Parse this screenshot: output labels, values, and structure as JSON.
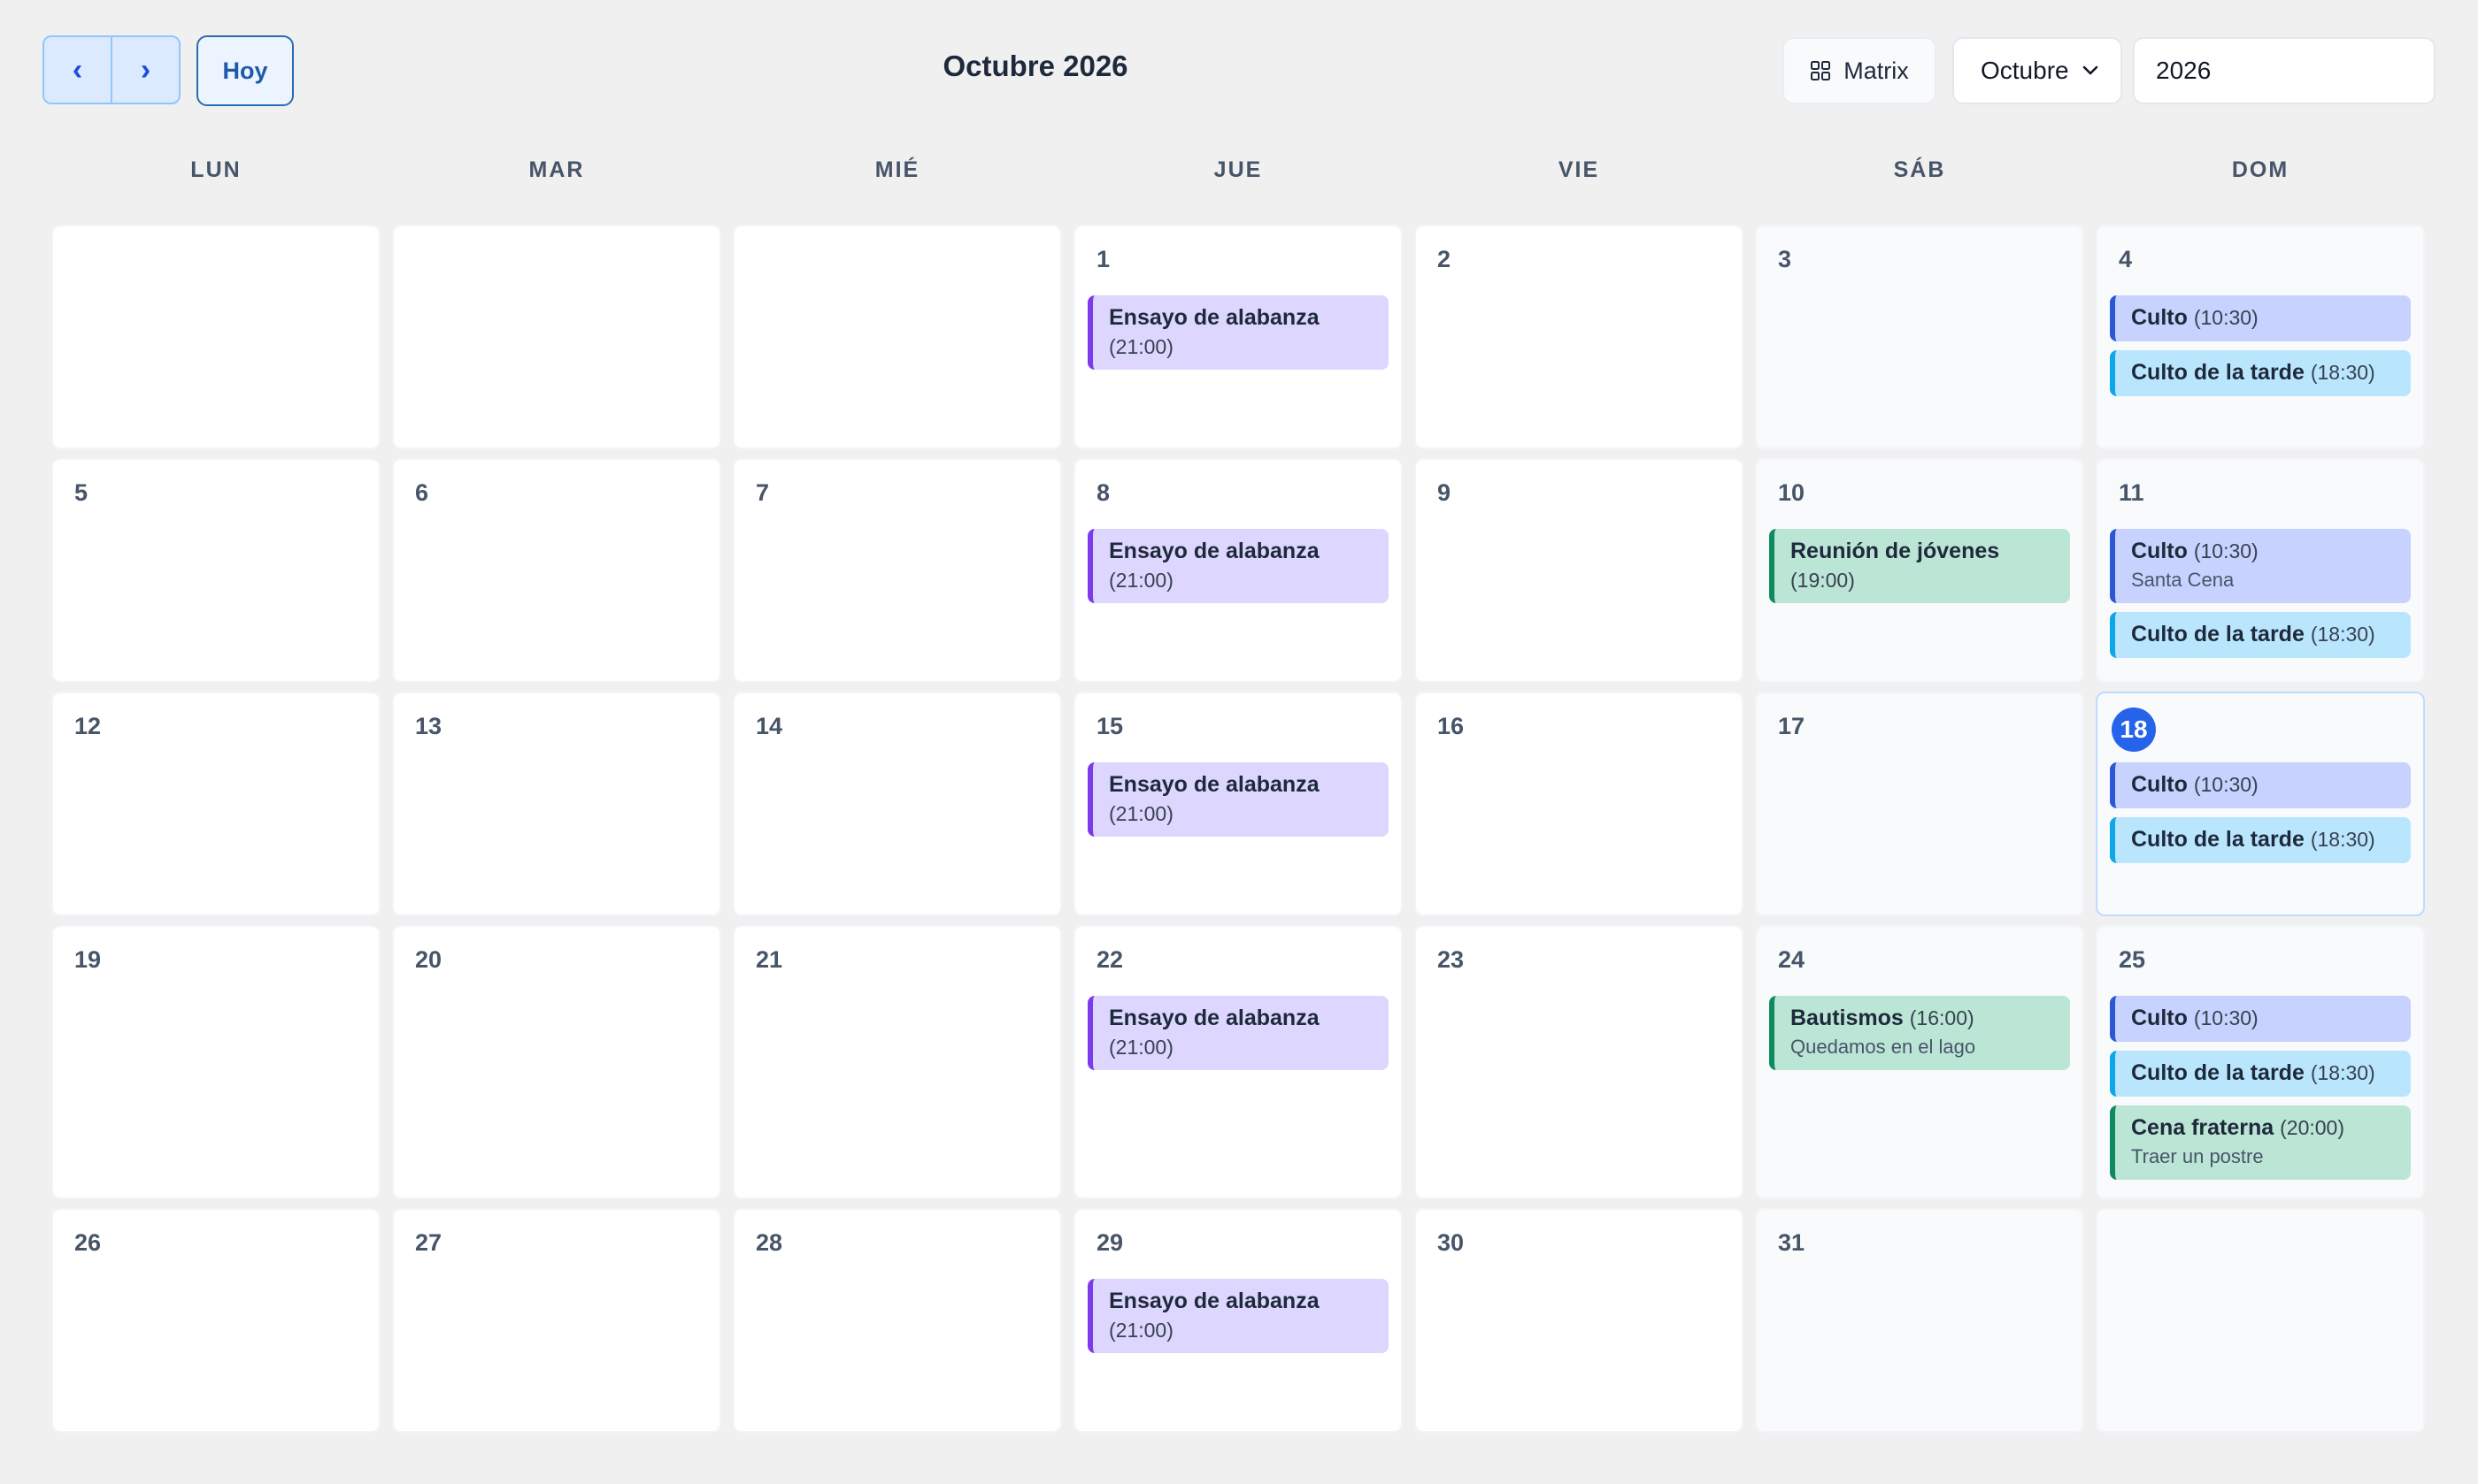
{
  "toolbar": {
    "prev_label": "‹",
    "next_label": "›",
    "today_label": "Hoy",
    "title": "Octubre 2026",
    "view_label": "Matrix",
    "view_icon": "grid-icon",
    "month_selected": "Octubre",
    "year_value": "2026"
  },
  "weekdays": [
    "LUN",
    "MAR",
    "MIÉ",
    "JUE",
    "VIE",
    "SÁB",
    "DOM"
  ],
  "colors": {
    "purple": "#7c3aed",
    "blue": "#2b56d4",
    "sky": "#0ea5e9",
    "green": "#0f8a5f",
    "today": "#2563eb"
  },
  "weeks": [
    {
      "days": [
        {
          "num": ""
        },
        {
          "num": ""
        },
        {
          "num": ""
        },
        {
          "num": "1",
          "events": [
            {
              "title": "Ensayo de alabanza",
              "time": "(21:00)",
              "color": "purple",
              "stack": true
            }
          ]
        },
        {
          "num": "2"
        },
        {
          "num": "3"
        },
        {
          "num": "4",
          "events": [
            {
              "title": "Culto",
              "time": "(10:30)",
              "color": "blue"
            },
            {
              "title": "Culto de la tarde",
              "time": "(18:30)",
              "color": "sky"
            }
          ]
        }
      ]
    },
    {
      "days": [
        {
          "num": "5"
        },
        {
          "num": "6"
        },
        {
          "num": "7"
        },
        {
          "num": "8",
          "events": [
            {
              "title": "Ensayo de alabanza",
              "time": "(21:00)",
              "color": "purple",
              "stack": true
            }
          ]
        },
        {
          "num": "9"
        },
        {
          "num": "10",
          "events": [
            {
              "title": "Reunión de jóvenes",
              "time": "(19:00)",
              "color": "green",
              "stack": true
            }
          ]
        },
        {
          "num": "11",
          "events": [
            {
              "title": "Culto",
              "time": "(10:30)",
              "note": "Santa Cena",
              "color": "blue"
            },
            {
              "title": "Culto de la tarde",
              "time": "(18:30)",
              "color": "sky"
            }
          ]
        }
      ]
    },
    {
      "days": [
        {
          "num": "12"
        },
        {
          "num": "13"
        },
        {
          "num": "14"
        },
        {
          "num": "15",
          "events": [
            {
              "title": "Ensayo de alabanza",
              "time": "(21:00)",
              "color": "purple",
              "stack": true
            }
          ]
        },
        {
          "num": "16"
        },
        {
          "num": "17"
        },
        {
          "num": "18",
          "today": true,
          "events": [
            {
              "title": "Culto",
              "time": "(10:30)",
              "color": "blue"
            },
            {
              "title": "Culto de la tarde",
              "time": "(18:30)",
              "color": "sky"
            }
          ]
        }
      ]
    },
    {
      "days": [
        {
          "num": "19"
        },
        {
          "num": "20"
        },
        {
          "num": "21"
        },
        {
          "num": "22",
          "events": [
            {
              "title": "Ensayo de alabanza",
              "time": "(21:00)",
              "color": "purple",
              "stack": true
            }
          ]
        },
        {
          "num": "23"
        },
        {
          "num": "24",
          "events": [
            {
              "title": "Bautismos",
              "time": "(16:00)",
              "note": "Quedamos en el lago",
              "color": "green"
            }
          ]
        },
        {
          "num": "25",
          "events": [
            {
              "title": "Culto",
              "time": "(10:30)",
              "color": "blue"
            },
            {
              "title": "Culto de la tarde",
              "time": "(18:30)",
              "color": "sky"
            },
            {
              "title": "Cena fraterna",
              "time": "(20:00)",
              "note": "Traer un postre",
              "color": "green"
            }
          ]
        }
      ]
    },
    {
      "days": [
        {
          "num": "26"
        },
        {
          "num": "27"
        },
        {
          "num": "28"
        },
        {
          "num": "29",
          "events": [
            {
              "title": "Ensayo de alabanza",
              "time": "(21:00)",
              "color": "purple",
              "stack": true
            }
          ]
        },
        {
          "num": "30"
        },
        {
          "num": "31"
        },
        {
          "num": ""
        }
      ]
    }
  ]
}
